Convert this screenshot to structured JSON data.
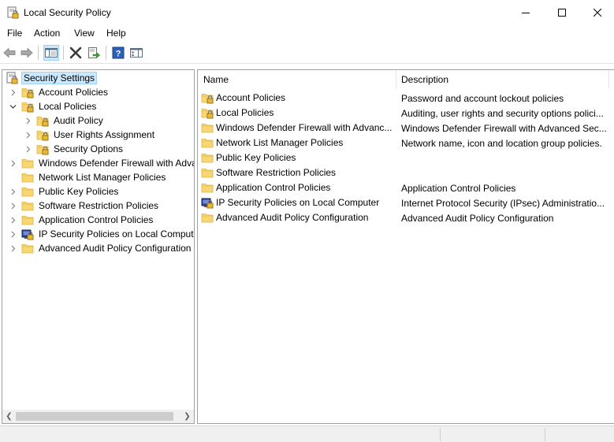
{
  "window": {
    "title": "Local Security Policy",
    "icon": "security-policy-icon"
  },
  "menu": [
    "File",
    "Action",
    "View",
    "Help"
  ],
  "toolbar": {
    "buttons": [
      "back-arrow-icon",
      "forward-arrow-icon",
      "show-hide-tree-icon",
      "delete-icon",
      "export-list-icon",
      "help-icon",
      "properties-icon"
    ]
  },
  "tree": {
    "root": "Security Settings",
    "items": [
      {
        "label": "Account Policies",
        "icon": "folder-lock-icon",
        "level": 1,
        "expander": "collapsed"
      },
      {
        "label": "Local Policies",
        "icon": "folder-lock-icon",
        "level": 1,
        "expander": "expanded"
      },
      {
        "label": "Audit Policy",
        "icon": "folder-lock-icon",
        "level": 2,
        "expander": "collapsed"
      },
      {
        "label": "User Rights Assignment",
        "icon": "folder-lock-icon",
        "level": 2,
        "expander": "collapsed"
      },
      {
        "label": "Security Options",
        "icon": "folder-lock-icon",
        "level": 2,
        "expander": "collapsed"
      },
      {
        "label": "Windows Defender Firewall with Adva",
        "icon": "folder-icon",
        "level": 1,
        "expander": "collapsed"
      },
      {
        "label": "Network List Manager Policies",
        "icon": "folder-icon",
        "level": 1,
        "expander": "none"
      },
      {
        "label": "Public Key Policies",
        "icon": "folder-icon",
        "level": 1,
        "expander": "collapsed"
      },
      {
        "label": "Software Restriction Policies",
        "icon": "folder-icon",
        "level": 1,
        "expander": "collapsed"
      },
      {
        "label": "Application Control Policies",
        "icon": "folder-icon",
        "level": 1,
        "expander": "collapsed"
      },
      {
        "label": "IP Security Policies on Local Compute",
        "icon": "ipsec-policy-icon",
        "level": 1,
        "expander": "collapsed"
      },
      {
        "label": "Advanced Audit Policy Configuration",
        "icon": "folder-icon",
        "level": 1,
        "expander": "collapsed"
      }
    ]
  },
  "list": {
    "columns": [
      "Name",
      "Description"
    ],
    "rows": [
      {
        "name": "Account Policies",
        "icon": "folder-lock-icon",
        "description": "Password and account lockout policies"
      },
      {
        "name": "Local Policies",
        "icon": "folder-lock-icon",
        "description": "Auditing, user rights and security options polici..."
      },
      {
        "name": "Windows Defender Firewall with Advanc...",
        "icon": "folder-icon",
        "description": "Windows Defender Firewall with Advanced Sec..."
      },
      {
        "name": "Network List Manager Policies",
        "icon": "folder-icon",
        "description": "Network name, icon and location group policies."
      },
      {
        "name": "Public Key Policies",
        "icon": "folder-icon",
        "description": ""
      },
      {
        "name": "Software Restriction Policies",
        "icon": "folder-icon",
        "description": ""
      },
      {
        "name": "Application Control Policies",
        "icon": "folder-icon",
        "description": "Application Control Policies"
      },
      {
        "name": "IP Security Policies on Local Computer",
        "icon": "ipsec-policy-icon",
        "description": "Internet Protocol Security (IPsec) Administratio..."
      },
      {
        "name": "Advanced Audit Policy Configuration",
        "icon": "folder-icon",
        "description": "Advanced Audit Policy Configuration"
      }
    ]
  },
  "colors": {
    "folder": "#f7d674",
    "folder_dark": "#e0b33f",
    "selection": "#cce8ff",
    "selection_border": "#99d1ff",
    "help_blue": "#2b5fb8"
  }
}
